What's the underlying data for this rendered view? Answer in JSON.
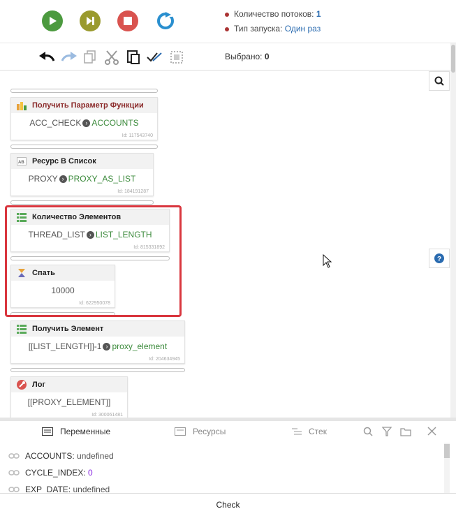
{
  "top": {
    "threads_label": "Количество потоков:",
    "threads_value": "1",
    "launch_label": "Тип запуска:",
    "launch_value": "Один раз"
  },
  "toolbar": {
    "selected_label": "Выбрано:",
    "selected_value": "0"
  },
  "blocks": [
    {
      "title": "Получить Параметр Функции",
      "from": "ACC_CHECK",
      "to": "ACCOUNTS",
      "id": "Id: 117543740",
      "icon": "function-param-icon"
    },
    {
      "title": "Ресурс В Список",
      "from": "PROXY",
      "to": "PROXY_AS_LIST",
      "id": "Id: 184191287",
      "icon": "resource-list-icon"
    },
    {
      "title": "Количество Элементов",
      "from": "THREAD_LIST",
      "to": "LIST_LENGTH",
      "id": "Id: 815331892",
      "icon": "list-icon"
    },
    {
      "title": "Спать",
      "text": "10000",
      "id": "Id: 622950078",
      "icon": "hourglass-icon"
    },
    {
      "title": "Получить Элемент",
      "from": "[[LIST_LENGTH]]-1",
      "to": "proxy_element",
      "id": "Id: 204634945",
      "icon": "list-icon"
    },
    {
      "title": "Лог",
      "text": "[[PROXY_ELEMENT]]",
      "id": "Id: 300061481",
      "icon": "wrench-icon"
    }
  ],
  "bottom": {
    "tabs": [
      "Переменные",
      "Ресурсы",
      "Стек"
    ],
    "variables": [
      {
        "name": "ACCOUNTS:",
        "value": "undefined"
      },
      {
        "name": "CYCLE_INDEX:",
        "value": "0"
      },
      {
        "name": "EXP_DATE:",
        "value": "undefined"
      }
    ]
  },
  "footer": {
    "label": "Check"
  },
  "colors": {
    "play": "#4c9a3f",
    "next": "#9a9a2e",
    "stop": "#d9534f",
    "refresh": "#2a8fcf",
    "selection": "#d9363e",
    "accent": "#2a6bb0"
  }
}
